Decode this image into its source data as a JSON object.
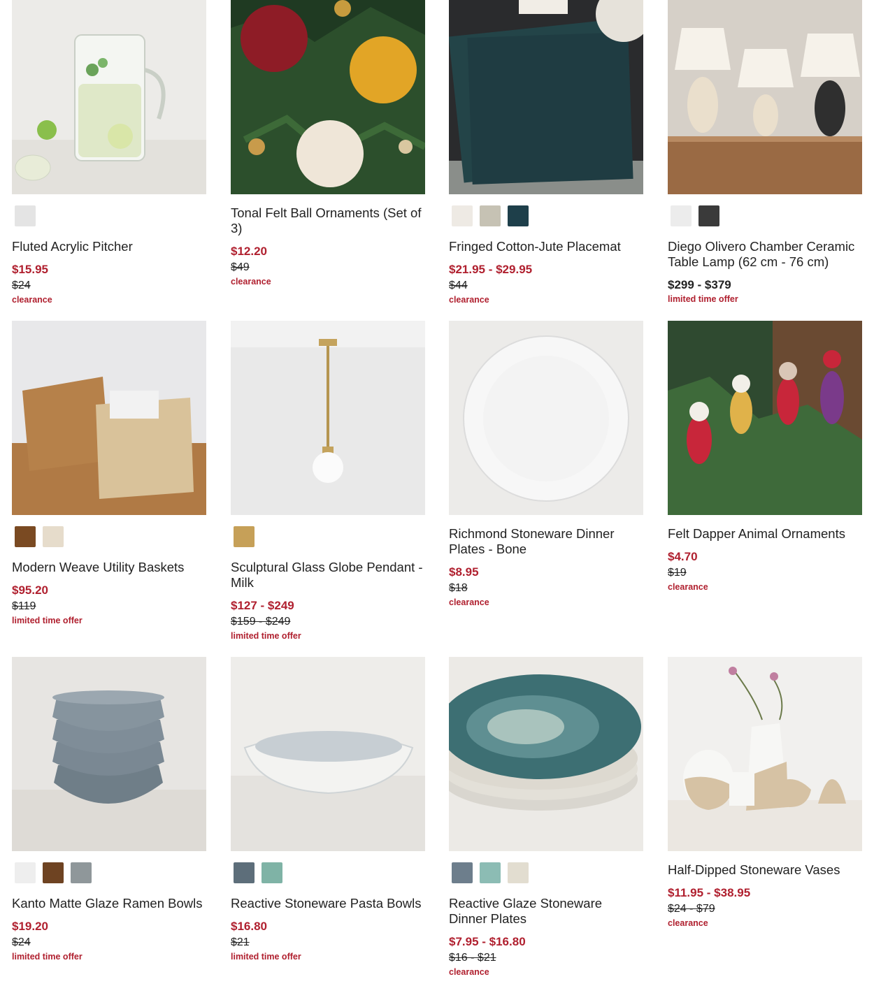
{
  "colors": {
    "sale": "#b0202f",
    "text": "#222222"
  },
  "products": [
    {
      "name": "Fluted Acrylic Pitcher",
      "sale_price": "$15.95",
      "regular_price": "$24",
      "badge": "clearance",
      "swatches": [
        "#e4e4e4"
      ]
    },
    {
      "name": "Tonal Felt Ball Ornaments (Set of 3)",
      "sale_price": "$12.20",
      "regular_price": "$49",
      "badge": "clearance",
      "swatches": []
    },
    {
      "name": "Fringed Cotton-Jute Placemat",
      "sale_price": "$21.95 - $29.95",
      "regular_price": "$44",
      "badge": "clearance",
      "swatches": [
        "#eeeae4",
        "#c6c2b4",
        "#1e3f4a"
      ]
    },
    {
      "name": "Diego Olivero Chamber Ceramic Table Lamp (62 cm - 76 cm)",
      "price": "$299 - $379",
      "badge": "limited time offer",
      "swatches": [
        "#ececec",
        "#3a3a3a"
      ]
    },
    {
      "name": "Modern Weave Utility Baskets",
      "sale_price": "$95.20",
      "regular_price": "$119",
      "badge": "limited time offer",
      "swatches": [
        "#7a4a22",
        "#e6dccb"
      ]
    },
    {
      "name": "Sculptural Glass Globe Pendant - Milk",
      "sale_price": "$127 - $249",
      "regular_price": "$159 - $249",
      "badge": "limited time offer",
      "swatches": [
        "#c6a058"
      ]
    },
    {
      "name": "Richmond Stoneware Dinner Plates - Bone",
      "sale_price": "$8.95",
      "regular_price": "$18",
      "badge": "clearance",
      "swatches": []
    },
    {
      "name": "Felt Dapper Animal Ornaments",
      "sale_price": "$4.70",
      "regular_price": "$19",
      "badge": "clearance",
      "swatches": []
    },
    {
      "name": "Kanto Matte Glaze Ramen Bowls",
      "sale_price": "$19.20",
      "regular_price": "$24",
      "badge": "limited time offer",
      "swatches": [
        "#eeeeee",
        "#6e4322",
        "#8f979a"
      ]
    },
    {
      "name": "Reactive Stoneware Pasta Bowls",
      "sale_price": "$16.80",
      "regular_price": "$21",
      "badge": "limited time offer",
      "swatches": [
        "#5d6e7a",
        "#7fb3a6"
      ]
    },
    {
      "name": "Reactive Glaze Stoneware Dinner Plates",
      "sale_price": "$7.95 - $16.80",
      "regular_price": "$16 - $21",
      "badge": "clearance",
      "swatches": [
        "#6d7e8c",
        "#8cbcb4",
        "#e2ddd0"
      ]
    },
    {
      "name": "Half-Dipped Stoneware Vases",
      "sale_price": "$11.95 - $38.95",
      "regular_price": "$24 - $79",
      "badge": "clearance",
      "swatches": []
    }
  ]
}
